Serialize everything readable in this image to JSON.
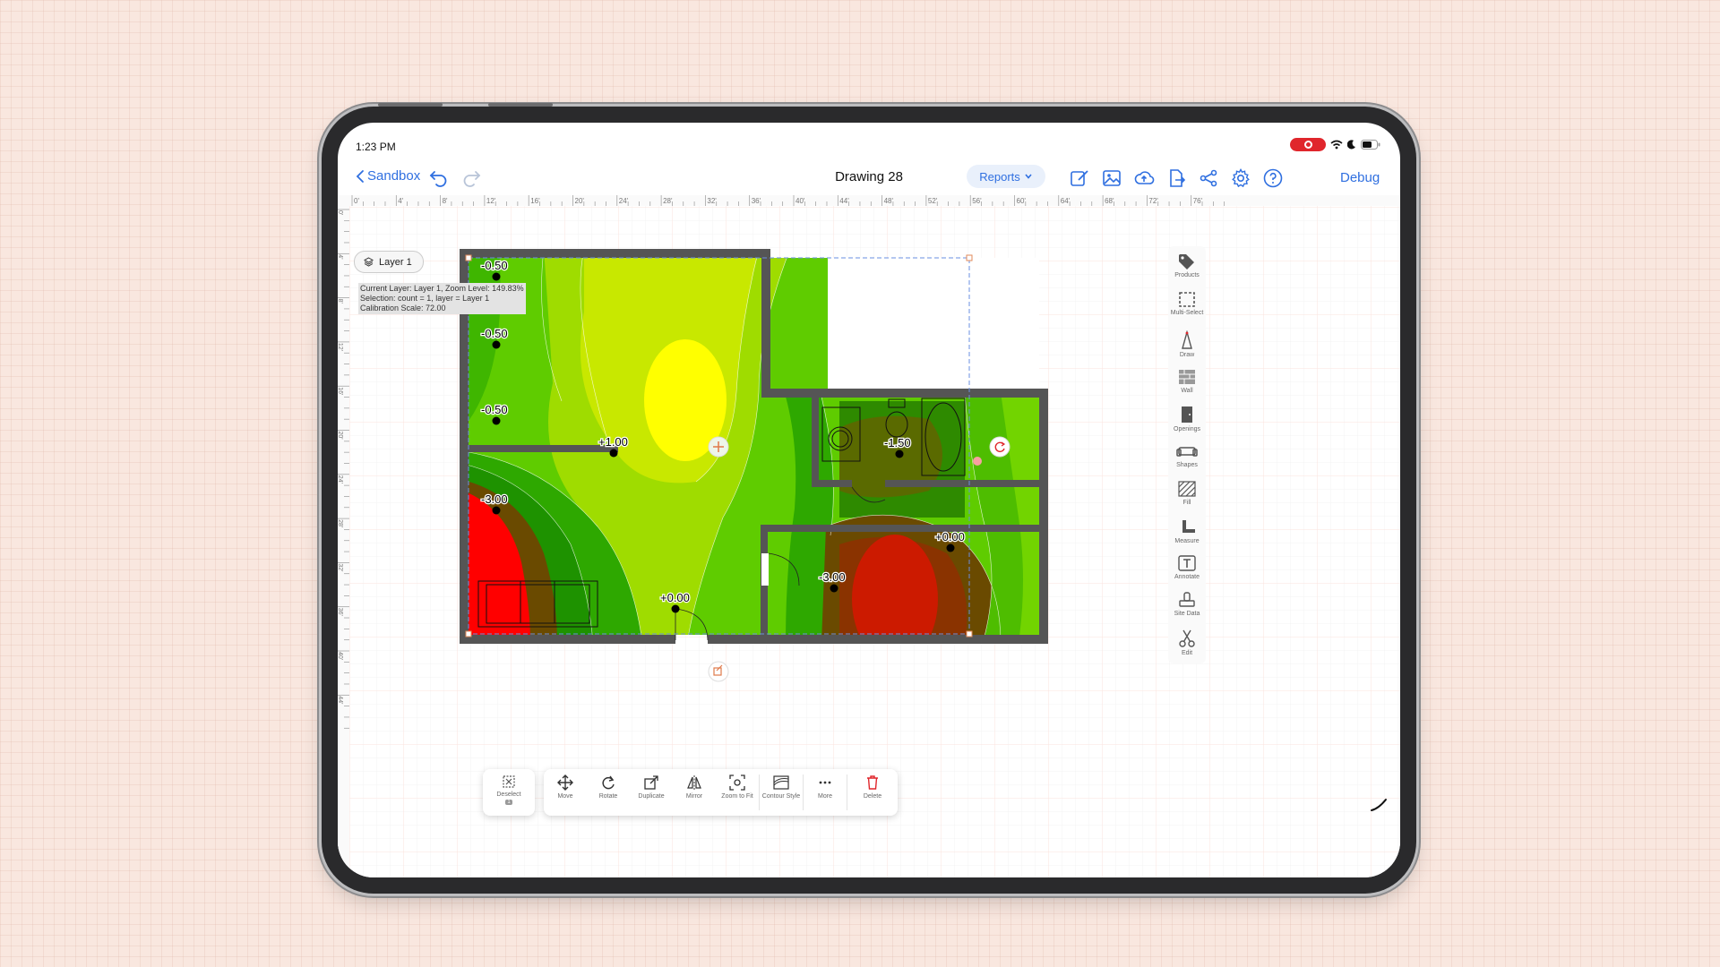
{
  "status": {
    "time": "1:23 PM"
  },
  "toolbar": {
    "back_label": "Sandbox",
    "title": "Drawing 28",
    "reports_label": "Reports",
    "debug_label": "Debug"
  },
  "ruler": {
    "top_labels": [
      "0'",
      "4'",
      "8'",
      "12'",
      "16'",
      "20'",
      "24'",
      "28'",
      "32'",
      "36'",
      "40'",
      "44'",
      "48'",
      "52'",
      "56'",
      "60'",
      "64'",
      "68'",
      "72'",
      "76'"
    ],
    "left_labels": [
      "0'",
      "4'",
      "8'",
      "12'",
      "16'",
      "20'",
      "24'",
      "28'",
      "32'",
      "36'",
      "40'",
      "44'"
    ]
  },
  "layer": {
    "label": "Layer 1"
  },
  "info": {
    "line1": "Current Layer: Layer 1, Zoom Level: 149.83%",
    "line2": "Selection: count = 1, layer = Layer 1",
    "line3": "Calibration Scale: 72.00"
  },
  "points": [
    {
      "label": "-0.50"
    },
    {
      "label": "-0.50"
    },
    {
      "label": "-0.50"
    },
    {
      "label": "+1.00"
    },
    {
      "label": "-3.00"
    },
    {
      "label": "+0.00"
    },
    {
      "label": "-1.50"
    },
    {
      "label": "+0.00"
    },
    {
      "label": "-3.00"
    }
  ],
  "right_tools": [
    {
      "label": "Products",
      "icon": "tag-icon"
    },
    {
      "label": "Multi-Select",
      "icon": "multi-select-icon"
    },
    {
      "label": "Draw",
      "icon": "draw-icon"
    },
    {
      "label": "Wall",
      "icon": "wall-icon"
    },
    {
      "label": "Openings",
      "icon": "door-icon"
    },
    {
      "label": "Shapes",
      "icon": "sofa-icon"
    },
    {
      "label": "Fill",
      "icon": "fill-icon"
    },
    {
      "label": "Measure",
      "icon": "measure-icon"
    },
    {
      "label": "Annotate",
      "icon": "text-icon"
    },
    {
      "label": "Site Data",
      "icon": "site-data-icon"
    },
    {
      "label": "Edit",
      "icon": "scissors-icon"
    }
  ],
  "bottom_tools": {
    "deselect": {
      "label": "Deselect",
      "badge": "1"
    },
    "items": [
      {
        "label": "Move"
      },
      {
        "label": "Rotate"
      },
      {
        "label": "Duplicate"
      },
      {
        "label": "Mirror"
      },
      {
        "label": "Zoom to Fit"
      },
      {
        "label": "Contour Style"
      },
      {
        "label": "More"
      },
      {
        "label": "Delete"
      }
    ]
  },
  "colors": {
    "accent": "#2f6fe0",
    "contour_yellow": "#ffff00",
    "contour_green": "#2ea800",
    "contour_red": "#ff0000",
    "wall": "#555555",
    "delete": "#e0262c"
  }
}
